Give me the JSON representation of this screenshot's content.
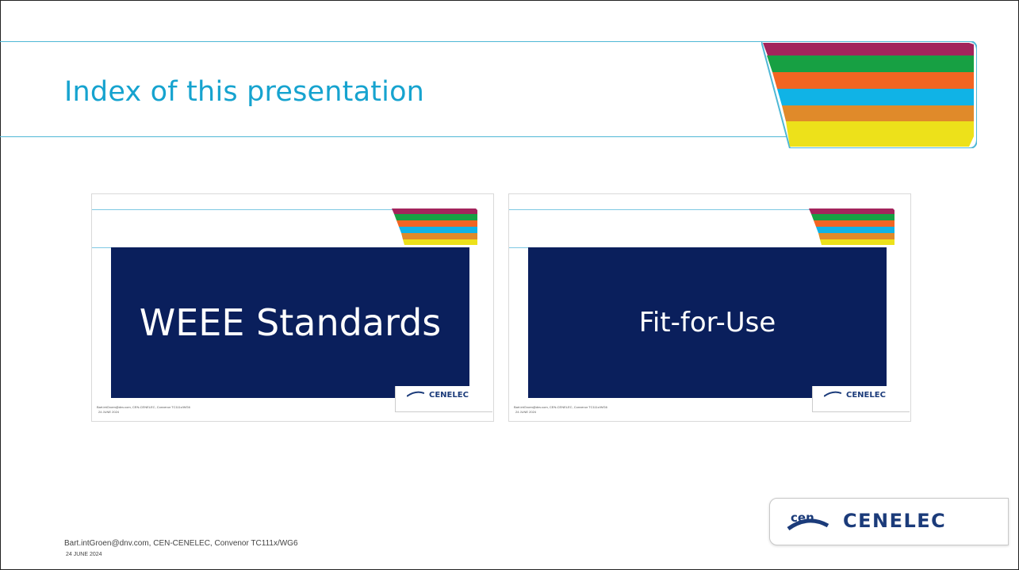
{
  "slide": {
    "title": "Index of this presentation",
    "footer_text": "Bart.intGroen@dnv.com, CEN-CENELEC, Convenor TC111x/WG6",
    "footer_date": "24 JUNE 2024"
  },
  "stripe_colors": [
    "#a3245c",
    "#17a043",
    "#f26522",
    "#10b3e6",
    "#e08a2a",
    "#ede11a"
  ],
  "thumbnails": [
    {
      "label": "WEEE Standards"
    },
    {
      "label": "Fit-for-Use"
    }
  ],
  "thumbnail_footer": "Bart.intGroen@dnv.com, CEN-CENELEC, Convenor TC111x/WG6",
  "thumbnail_date": "24 JUNE 2024",
  "thumbnail_logo_text": "CENELEC",
  "logo": {
    "cen_text": "cen",
    "cenelec_text": "CENELEC",
    "brand_color": "#1b3b7a"
  },
  "colors": {
    "title": "#16a3cf",
    "navy": "#0a1f5c",
    "rule": "#4fb8d6"
  }
}
